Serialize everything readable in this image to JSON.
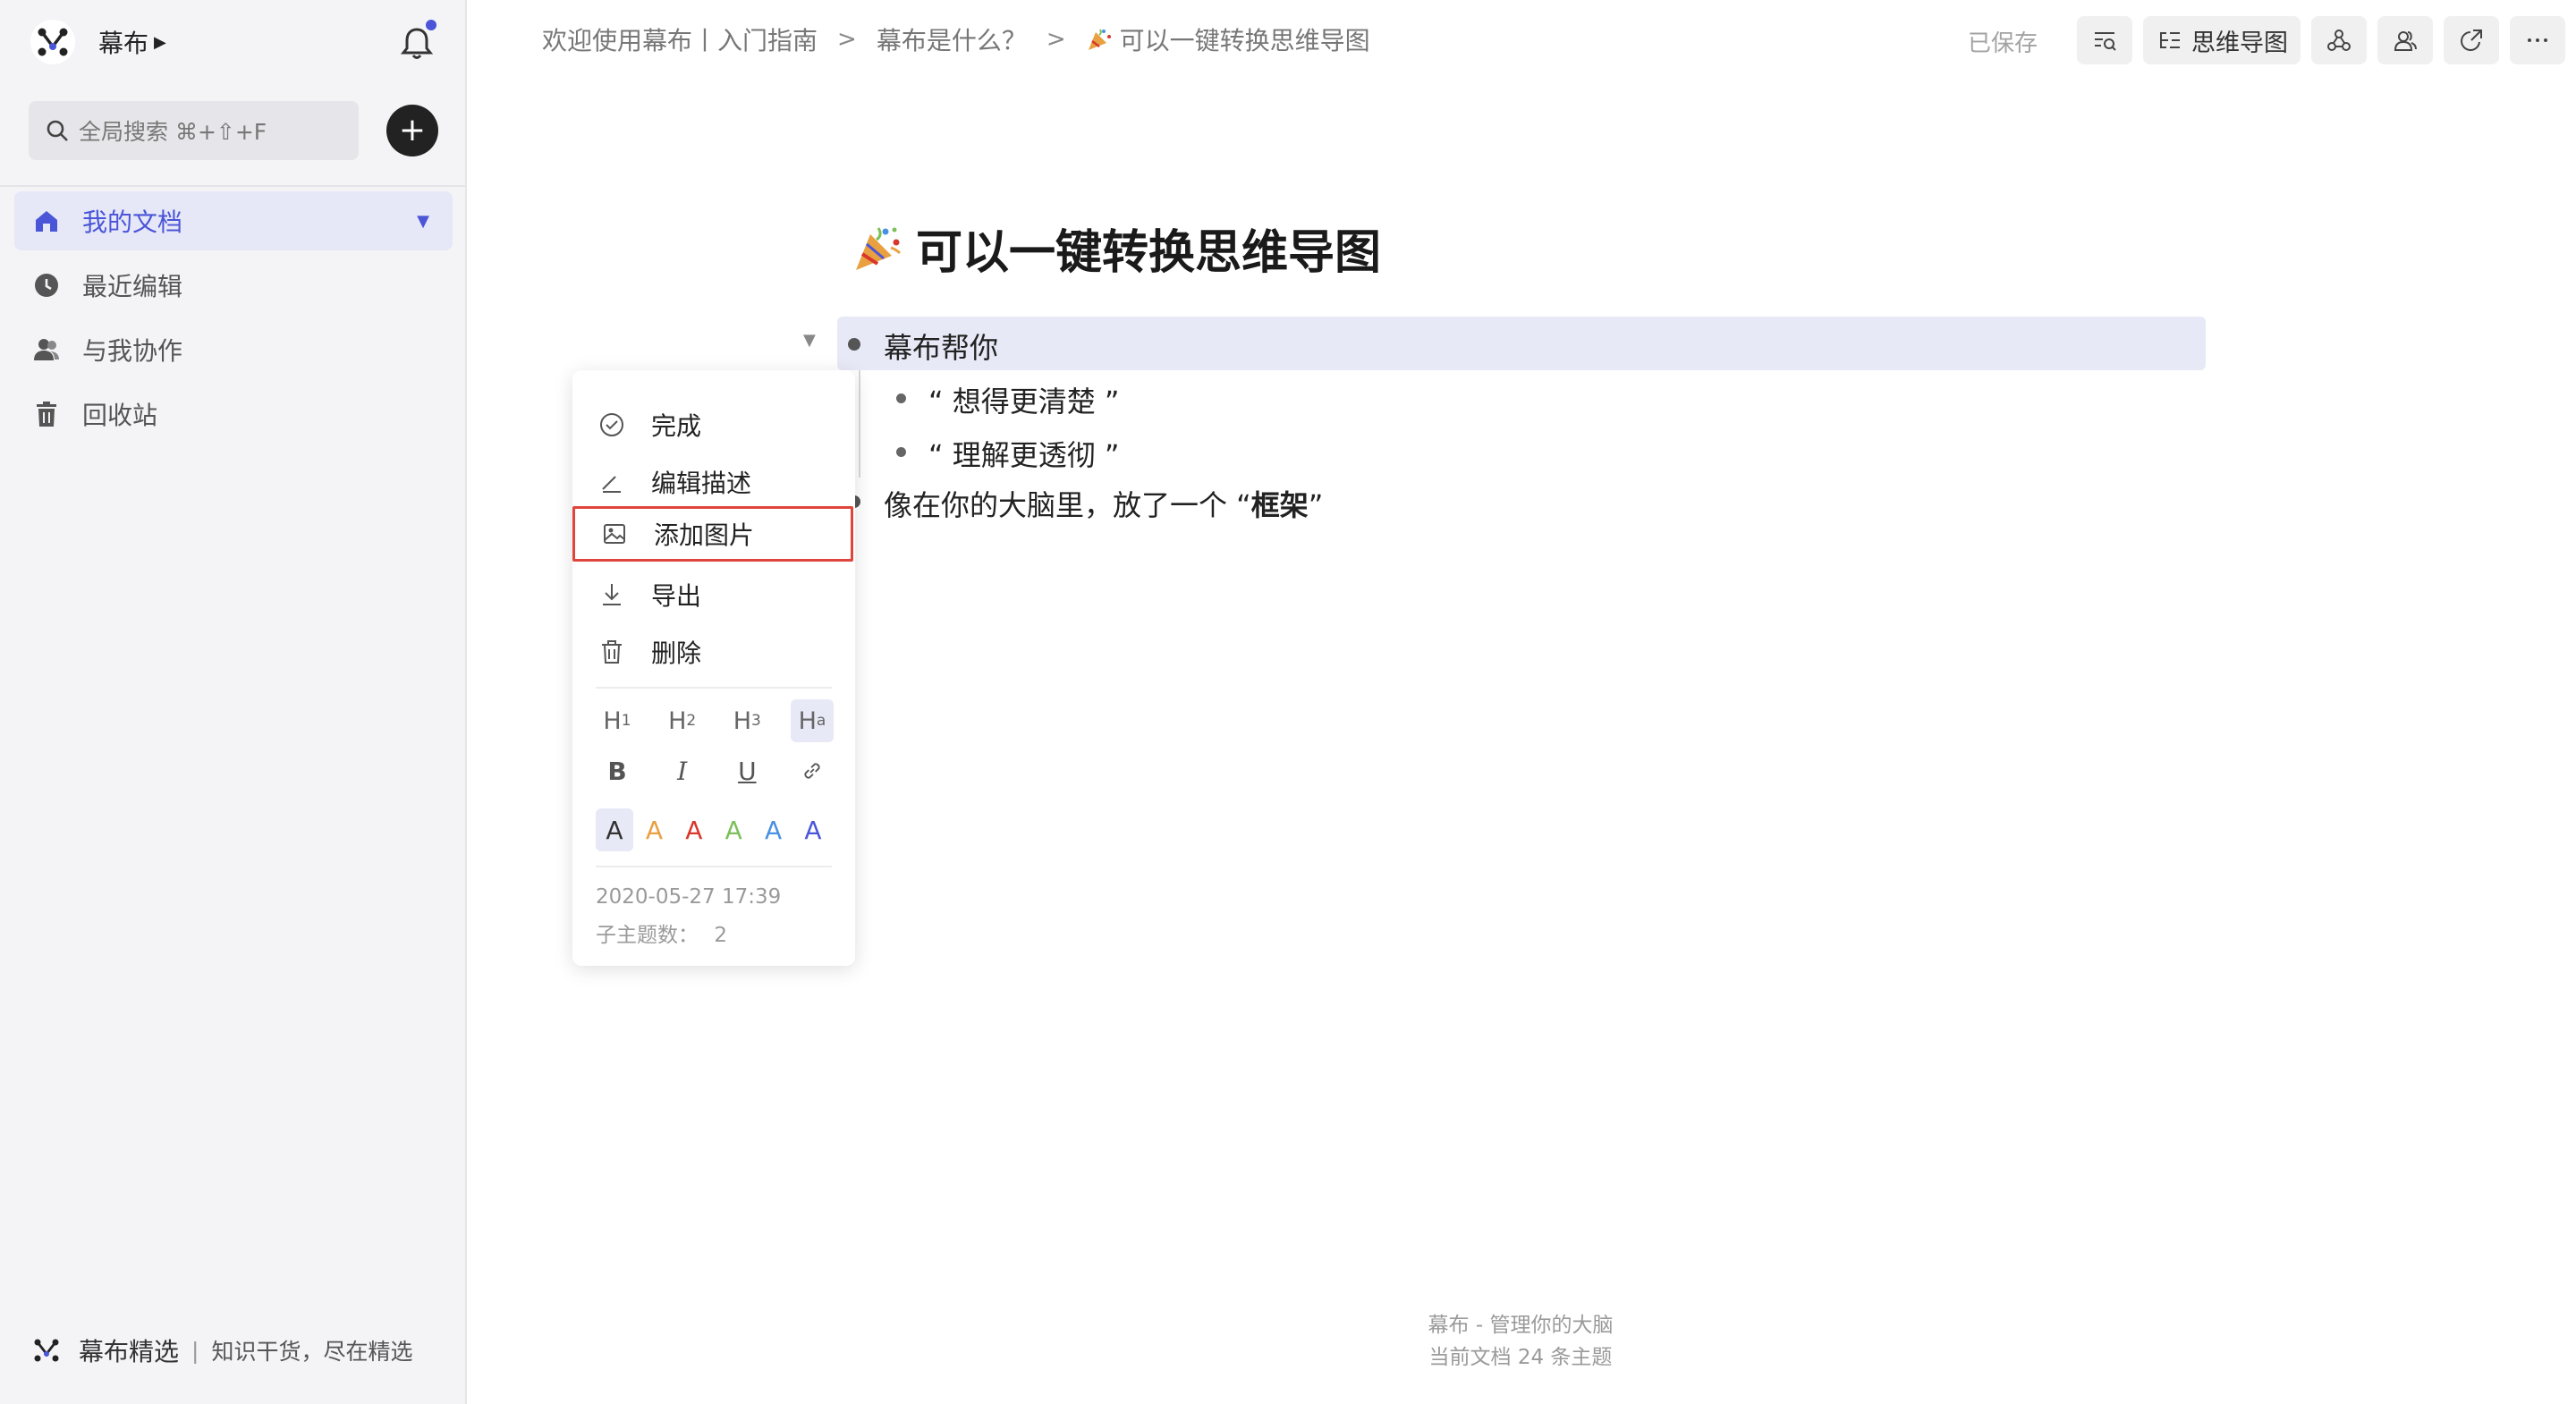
{
  "sidebar": {
    "brand_name": "幕布",
    "search_placeholder": "全局搜索 ⌘+⇧+F",
    "nav": [
      {
        "label": "我的文档",
        "icon": "home-icon",
        "active": true
      },
      {
        "label": "最近编辑",
        "icon": "clock-icon"
      },
      {
        "label": "与我协作",
        "icon": "users-icon"
      },
      {
        "label": "回收站",
        "icon": "trash-icon"
      }
    ],
    "footer_title": "幕布精选",
    "footer_separator": "|",
    "footer_tagline": "知识干货，尽在精选"
  },
  "topbar": {
    "breadcrumb": [
      "欢迎使用幕布丨入门指南",
      "幕布是什么？",
      "可以一键转换思维导图"
    ],
    "breadcrumb_separator": ">",
    "saved_label": "已保存",
    "mindmap_label": "思维导图",
    "buttons": [
      "outline-search-icon",
      "mindmap-icon",
      "share-graph-icon",
      "collaborators-icon",
      "export-icon",
      "more-icon"
    ]
  },
  "document": {
    "title": "可以一键转换思维导图",
    "title_icon": "party-popper-icon",
    "nodes": [
      {
        "text": "幕布帮你",
        "children": [
          {
            "text": "“ 想得更清楚 ”"
          },
          {
            "text": "“ 理解更透彻 ”"
          }
        ]
      },
      {
        "text_prefix": "像在你的大脑里，放了一个 “",
        "text_bold": "框架",
        "text_suffix": "”"
      }
    ]
  },
  "context_menu": {
    "items": [
      "完成",
      "编辑描述",
      "添加图片",
      "导出",
      "删除"
    ],
    "highlighted_item": "添加图片",
    "headings": [
      "H1",
      "H2",
      "H3",
      "Ha"
    ],
    "format": [
      "B",
      "I",
      "U",
      "link"
    ],
    "colors": [
      {
        "label": "A",
        "color": "#333333"
      },
      {
        "label": "A",
        "color": "#e8a040"
      },
      {
        "label": "A",
        "color": "#d9362b"
      },
      {
        "label": "A",
        "color": "#7cbf5a"
      },
      {
        "label": "A",
        "color": "#4a90e2"
      },
      {
        "label": "A",
        "color": "#4a55d8"
      }
    ],
    "date": "2020-05-27 17:39",
    "child_count_label": "子主题数：",
    "child_count": "2"
  },
  "footer": {
    "line1": "幕布 - 管理你的大脑",
    "line2": "当前文档 24 条主题"
  }
}
